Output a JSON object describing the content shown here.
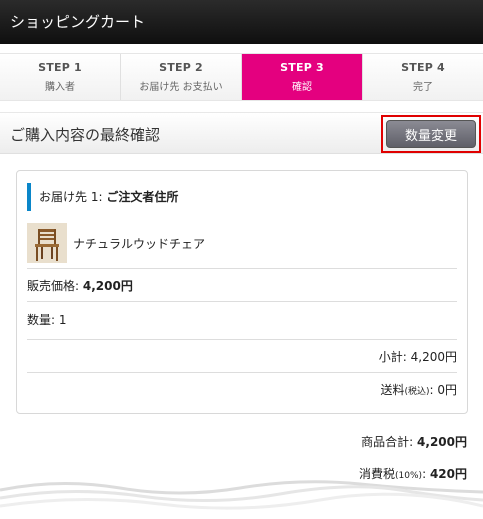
{
  "header": {
    "title": "ショッピングカート"
  },
  "steps": [
    {
      "num": "STEP 1",
      "label": "購入者"
    },
    {
      "num": "STEP 2",
      "label": "お届け先 お支払い"
    },
    {
      "num": "STEP 3",
      "label": "確認"
    },
    {
      "num": "STEP 4",
      "label": "完了"
    }
  ],
  "active_step": "STEP 3",
  "section": {
    "title": "ご購入内容の最終確認",
    "change_qty_label": "数量変更"
  },
  "order": {
    "destination_prefix": "お届け先 1: ",
    "destination_name": "ご注文者住所",
    "product_name": "ナチュラルウッドチェア",
    "price_label": "販売価格: ",
    "price_value": "4,200円",
    "qty_label": "数量: ",
    "qty_value": "1",
    "subtotal_label": "小計: ",
    "subtotal_value": "4,200円",
    "shipping_label_pre": "送料",
    "shipping_label_small": "(税込)",
    "shipping_label_post": ": ",
    "shipping_value": "0円"
  },
  "summary": {
    "goods_total_label": "商品合計: ",
    "goods_total_value": "4,200円",
    "tax_label_pre": "消費税",
    "tax_label_small": "(10%)",
    "tax_label_post": ": ",
    "tax_value": "420円"
  },
  "colors": {
    "accent": "#e4007f",
    "dest_bar": "#0a86c9",
    "highlight": "#e00000"
  }
}
